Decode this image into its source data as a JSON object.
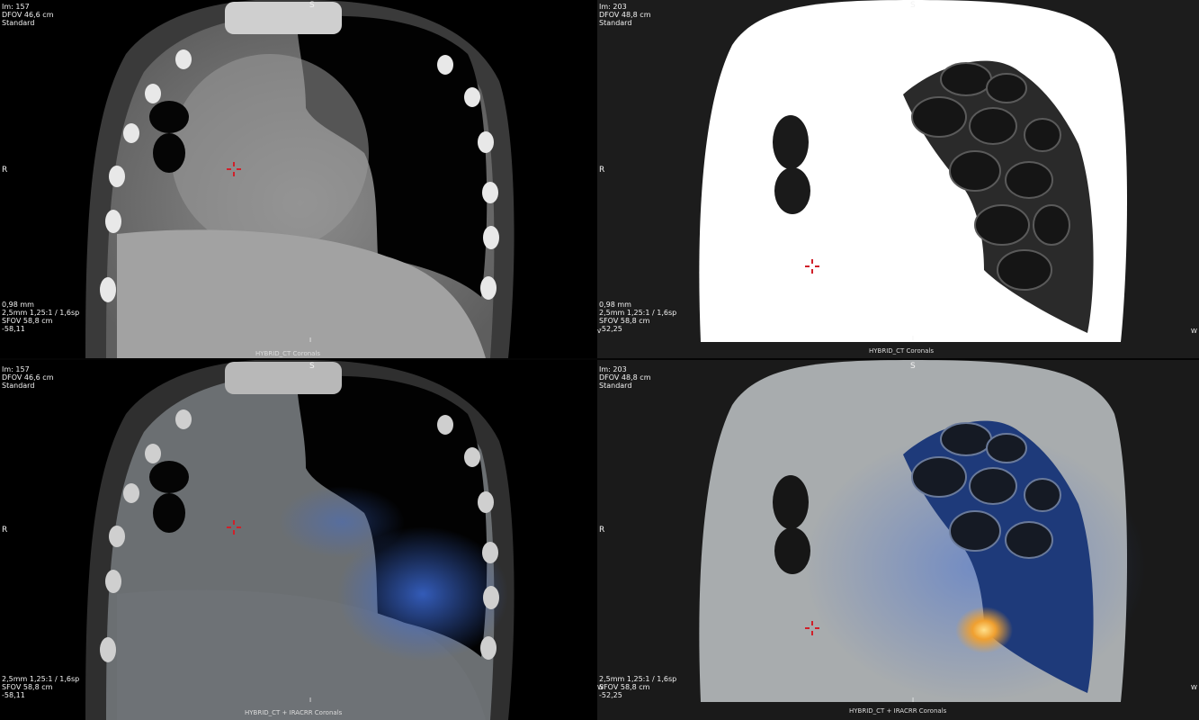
{
  "viewports": [
    {
      "id": "top-left",
      "info_top": [
        "Im: 157",
        "DFOV 46,6 cm",
        "Standard"
      ],
      "info_bottom": [
        "0,98 mm",
        "2,5mm 1,25:1 / 1,6sp",
        "SFOV 58,8 cm",
        "-58,11"
      ],
      "caption": "HYBRID_CT Coronals",
      "orient_top": "S",
      "orient_left": "R",
      "orient_bottom": "I"
    },
    {
      "id": "top-right",
      "info_top": [
        "Im: 203",
        "DFOV 48,8 cm",
        "Standard"
      ],
      "info_bottom": [
        "0,98 mm",
        "2,5mm 1,25:1 / 1,6sp",
        "SFOV 58,8 cm",
        "-52,25"
      ],
      "caption": "HYBRID_CT Coronals",
      "orient_top": "S",
      "orient_left": "R",
      "orient_bottom": "I",
      "side_left": "v",
      "side_right": "W"
    },
    {
      "id": "bottom-left",
      "info_top": [
        "Im: 157",
        "DFOV 46,6 cm",
        "Standard"
      ],
      "info_bottom": [
        "2,5mm 1,25:1 / 1,6sp",
        "SFOV 58,8 cm",
        "-58,11"
      ],
      "caption": "HYBRID_CT + IRACRR Coronals",
      "orient_top": "S",
      "orient_left": "R",
      "orient_bottom": "I"
    },
    {
      "id": "bottom-right",
      "info_top": [
        "Im: 203",
        "DFOV 48,8 cm",
        "Standard"
      ],
      "info_bottom": [
        "2,5mm 1,25:1 / 1,6sp",
        "SFOV 58,8 cm",
        "-52,25"
      ],
      "caption": "HYBRID_CT + IRACRR Coronals",
      "orient_top": "S",
      "orient_left": "R",
      "orient_bottom": "I",
      "side_left": "W",
      "side_right": "W"
    }
  ],
  "colors": {
    "background": "#000000",
    "crosshair": "#d0202a",
    "fusion_blue": "#3c6bd8",
    "fusion_hot": "#f0a030",
    "overlay_text": "#f2f2f2"
  }
}
